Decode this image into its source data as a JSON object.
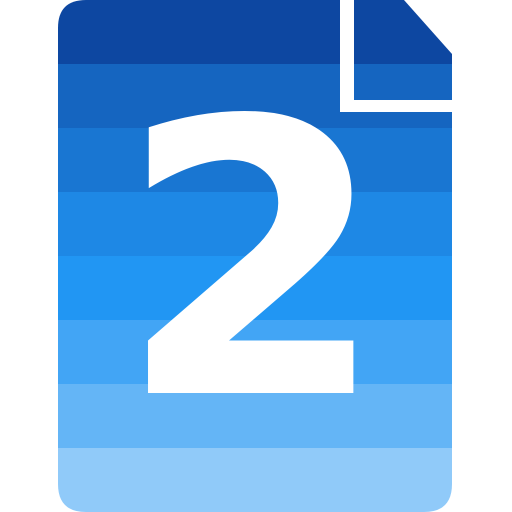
{
  "icon": {
    "name": "numbered-document-icon",
    "number": "2",
    "number_color": "#ffffff",
    "colors": {
      "band_1": "#0d47a1",
      "band_2": "#1565c0",
      "band_3": "#1976d2",
      "band_4": "#1e88e5",
      "band_5": "#2196f3",
      "band_6": "#42a5f5",
      "band_7": "#64b5f6",
      "band_8": "#90caf9",
      "fold": "#ffffff"
    }
  }
}
